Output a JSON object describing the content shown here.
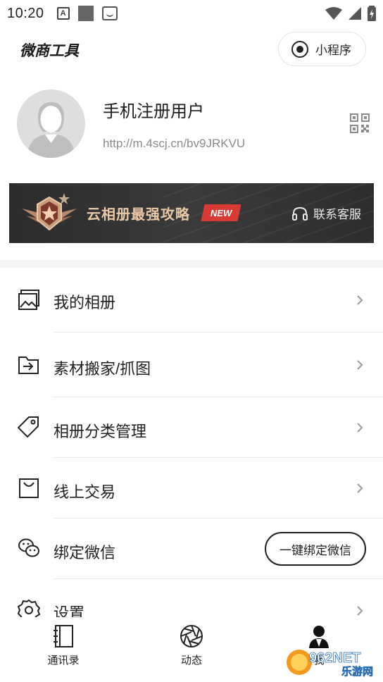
{
  "status_bar": {
    "time": "10:20",
    "a_icon": "A"
  },
  "header": {
    "brand": "微商工具",
    "mini_program": "小程序"
  },
  "profile": {
    "name": "手机注册用户",
    "url": "http://m.4scj.cn/bv9JRKVU"
  },
  "banner": {
    "title": "云相册最强攻略",
    "tag": "NEW",
    "service": "联系客服"
  },
  "menu": [
    {
      "label": "我的相册",
      "icon": "album-icon"
    },
    {
      "label": "素材搬家/抓图",
      "icon": "folder-import-icon"
    },
    {
      "label": "相册分类管理",
      "icon": "tag-icon"
    },
    {
      "label": "线上交易",
      "icon": "shopping-bag-icon"
    },
    {
      "label": "绑定微信",
      "icon": "wechat-icon",
      "action": "一键绑定微信"
    },
    {
      "label": "设置",
      "icon": "settings-icon"
    }
  ],
  "bottom_nav": [
    {
      "label": "通讯录",
      "icon": "contacts-icon"
    },
    {
      "label": "动态",
      "icon": "camera-aperture-icon"
    },
    {
      "label": "我",
      "icon": "user-icon"
    }
  ],
  "watermark": {
    "text_top": "962NET",
    "text_bottom": "乐游网"
  }
}
